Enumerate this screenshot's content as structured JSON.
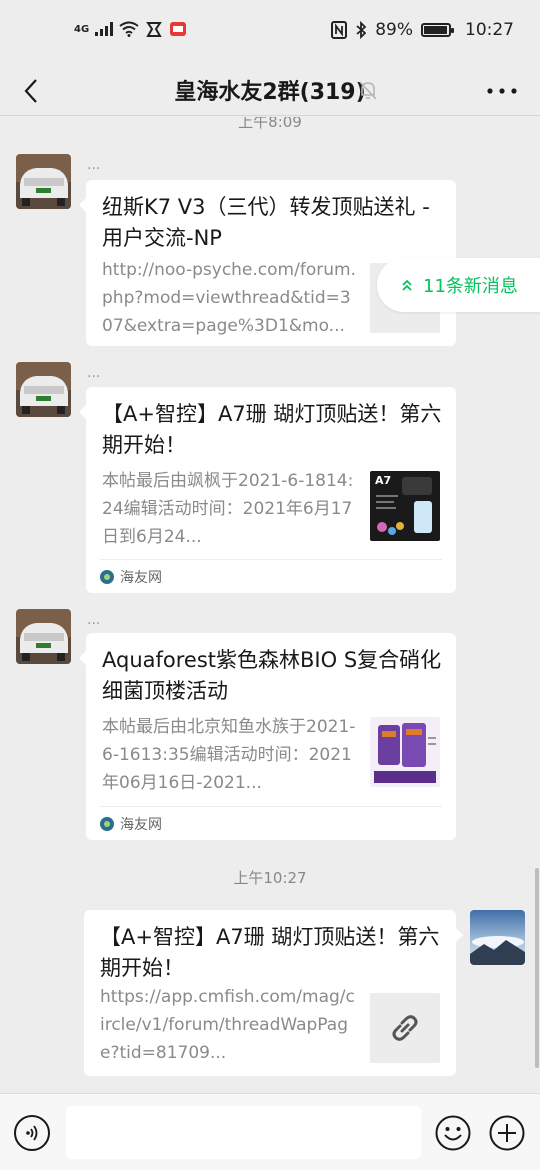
{
  "status_bar": {
    "network": "4G",
    "battery": "89%",
    "battery_level": 0.89,
    "time": "10:27"
  },
  "header": {
    "title": "皇海水友2群(319)"
  },
  "new_messages": {
    "label": "11条新消息"
  },
  "messages": [
    {
      "time": "上午8:09",
      "nick": "...",
      "title": "纽斯K7 V3（三代）转发顶贴送礼 - 用户交流-NP",
      "desc": "http://noo-psyche.com/forum.php?mod=viewthread&tid=307&extra=page%3D1&mo...",
      "thumb": "link-icon"
    },
    {
      "nick": "...",
      "title": "【A+智控】A7珊 瑚灯顶贴送！第六期开始！",
      "desc": "本帖最后由飒枫于2021-6-1814:24编辑活动时间：2021年6月17日到6月24...",
      "thumb_text": "A7",
      "source": "海友网"
    },
    {
      "nick": "...",
      "title": "Aquaforest紫色森林BIO S复合硝化细菌顶楼活动",
      "desc": "本帖最后由北京知鱼水族于2021-6-1613:35编辑活动时间：2021年06月16日-2021...",
      "source": "海友网"
    },
    {
      "time": "上午10:27",
      "title": "【A+智控】A7珊 瑚灯顶贴送！第六期开始！",
      "desc": "https://app.cmfish.com/mag/circle/v1/forum/threadWapPage?tid=81709...",
      "thumb": "link-icon"
    }
  ],
  "colors": {
    "accent": "#07c160",
    "background": "#ededed"
  }
}
